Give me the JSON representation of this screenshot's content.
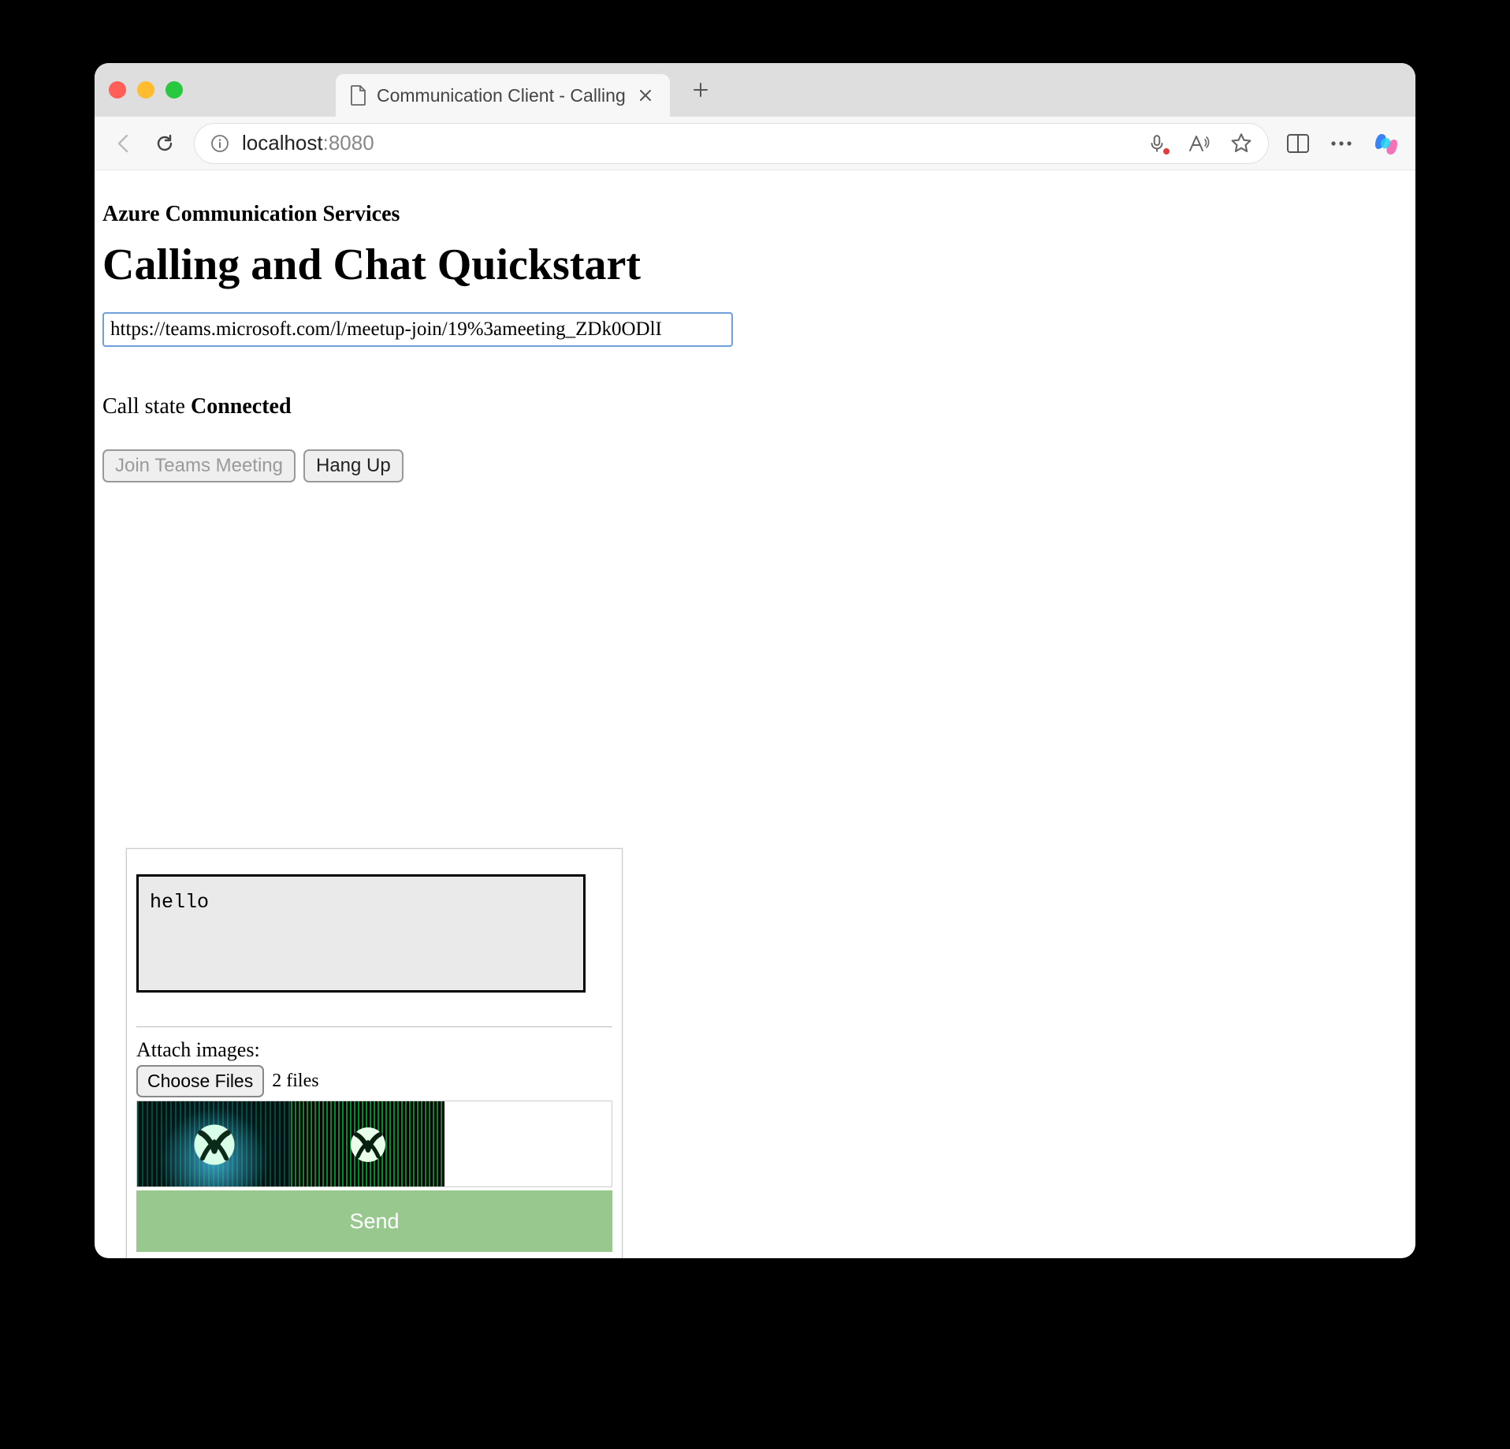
{
  "browser": {
    "tab_title": "Communication Client - Calling",
    "url_host": "localhost",
    "url_port": ":8080"
  },
  "page": {
    "heading_small": "Azure Communication Services",
    "heading_large": "Calling and Chat Quickstart",
    "meeting_url": "https://teams.microsoft.com/l/meetup-join/19%3ameeting_ZDk0ODlI",
    "call_state_label": "Call state ",
    "call_state_value": "Connected",
    "join_button": "Join Teams Meeting",
    "hangup_button": "Hang Up"
  },
  "chat": {
    "message_value": "hello",
    "attach_label": "Attach images:",
    "choose_files_label": "Choose Files",
    "file_count_text": "2 files",
    "send_label": "Send"
  }
}
